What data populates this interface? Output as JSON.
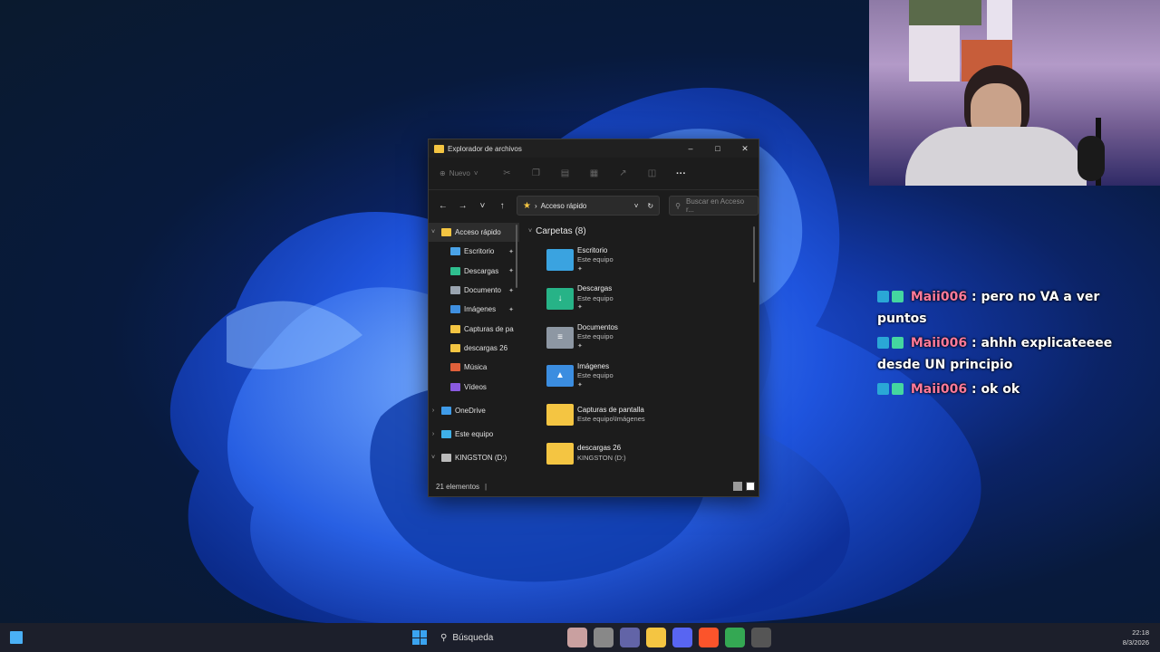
{
  "explorer": {
    "title": "Explorador de archivos",
    "toolbar": {
      "new_label": "Nuevo"
    },
    "address": {
      "path": "Acceso rápido"
    },
    "search": {
      "placeholder": "Buscar en Acceso r..."
    },
    "sidebar": {
      "items": [
        {
          "label": "Acceso rápido",
          "icon": "star-icon",
          "color": "#f4c542",
          "pinned": false,
          "expandable": "expanded"
        },
        {
          "label": "Escritorio",
          "icon": "desktop-icon",
          "color": "#4aa3e8",
          "pinned": true
        },
        {
          "label": "Descargas",
          "icon": "download-icon",
          "color": "#2fbf8f",
          "pinned": true
        },
        {
          "label": "Documento",
          "icon": "document-icon",
          "color": "#9aa4b0",
          "pinned": true
        },
        {
          "label": "Imágenes",
          "icon": "pictures-icon",
          "color": "#3f8fe0",
          "pinned": true
        },
        {
          "label": "Capturas de pa",
          "icon": "folder-icon",
          "color": "#f4c542",
          "pinned": false
        },
        {
          "label": "descargas 26",
          "icon": "folder-icon",
          "color": "#f4c542",
          "pinned": false
        },
        {
          "label": "Música",
          "icon": "music-icon",
          "color": "#e0603a",
          "pinned": false
        },
        {
          "label": "Vídeos",
          "icon": "video-icon",
          "color": "#8a5ae0",
          "pinned": false
        },
        {
          "label": "OneDrive",
          "icon": "cloud-icon",
          "color": "#3f9be8",
          "pinned": false,
          "expandable": "collapsed"
        },
        {
          "label": "Este equipo",
          "icon": "computer-icon",
          "color": "#3fb0e8",
          "pinned": false,
          "expandable": "collapsed"
        },
        {
          "label": "KINGSTON (D:)",
          "icon": "drive-icon",
          "color": "#bbbbbb",
          "pinned": false,
          "expandable": "expanded"
        }
      ]
    },
    "section": {
      "title": "Carpetas (8)"
    },
    "folders": [
      {
        "name": "Escritorio",
        "location": "Este equipo",
        "pinned": true,
        "icon": "desktop-folder-icon",
        "color": "#3aa3e0"
      },
      {
        "name": "Descargas",
        "location": "Este equipo",
        "pinned": true,
        "icon": "downloads-folder-icon",
        "color": "#27b387"
      },
      {
        "name": "Documentos",
        "location": "Este equipo",
        "pinned": true,
        "icon": "documents-folder-icon",
        "color": "#8d97a3"
      },
      {
        "name": "Imágenes",
        "location": "Este equipo",
        "pinned": true,
        "icon": "pictures-folder-icon",
        "color": "#3b8de0"
      },
      {
        "name": "Capturas de pantalla",
        "location": "Este equipo\\Imágenes",
        "pinned": false,
        "icon": "folder-icon",
        "color": "#f4c542"
      },
      {
        "name": "descargas 26",
        "location": "KINGSTON (D:)",
        "pinned": false,
        "icon": "folder-icon",
        "color": "#f4c542"
      }
    ],
    "status": {
      "count": "21 elementos"
    }
  },
  "chat": [
    {
      "user": "Maii006",
      "message": "pero no VA a ver puntos"
    },
    {
      "user": "Maii006",
      "message": "ahhh explicateeee desde UN principio"
    },
    {
      "user": "Maii006",
      "message": "ok ok"
    }
  ],
  "taskbar": {
    "search_label": "Búsqueda",
    "apps": [
      {
        "name": "widgets-icon",
        "color": "#c9a0a0"
      },
      {
        "name": "task-view-icon",
        "color": "#888888"
      },
      {
        "name": "teams-icon",
        "color": "#6264a7"
      },
      {
        "name": "file-explorer-icon",
        "color": "#f4c542"
      },
      {
        "name": "discord-icon",
        "color": "#5865f2"
      },
      {
        "name": "brave-icon",
        "color": "#fb542b"
      },
      {
        "name": "chrome-icon",
        "color": "#34a853"
      },
      {
        "name": "obs-icon",
        "color": "#555555"
      }
    ],
    "time": "22:18",
    "date": "8/3/2026"
  }
}
